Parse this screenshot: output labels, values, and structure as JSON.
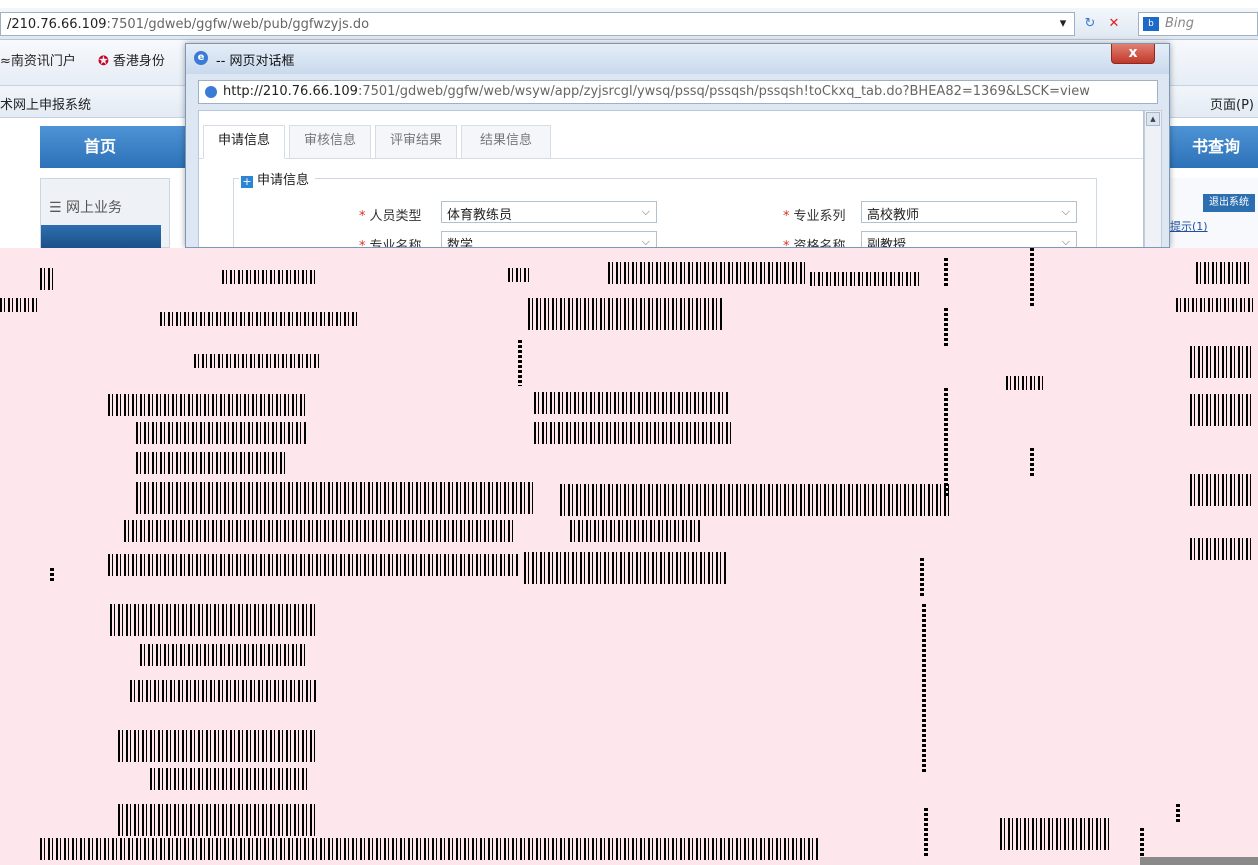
{
  "browser": {
    "address_host": "/210.76.66.109",
    "address_rest": ":7501/gdweb/ggfw/web/pub/ggfwzyjs.do",
    "search_placeholder": "Bing",
    "search_logo": "b",
    "fav1_label": "≈南资讯门户",
    "fav2_label": "香港身份",
    "fav3_label": "术网上申报系统",
    "page_menu": "页面(P)"
  },
  "site": {
    "nav_home": "首页",
    "nav_right": "书查询",
    "left_title": "网上业务",
    "logout": "退出系统",
    "right_link": "提示(1)"
  },
  "dialog": {
    "title": "-- 网页对话框",
    "close": "x",
    "url_host": "http://210.76.66.109",
    "url_rest": ":7501/gdweb/ggfw/web/wsyw/app/zyjsrcgl/ywsq/pssq/pssqsh/pssqsh!toCkxq_tab.do?BHEA82=1369&LSCK=view",
    "tabs": [
      {
        "label": "申请信息"
      },
      {
        "label": "审核信息"
      },
      {
        "label": "评审结果"
      },
      {
        "label": "结果信息"
      }
    ],
    "section_title": "申请信息",
    "fields": {
      "person_type_label": "人员类型",
      "person_type_value": "体育教练员",
      "series_label": "专业系列",
      "series_value": "高校教师",
      "major_label": "专业名称",
      "major_value": "数学",
      "qualification_label": "资格名称",
      "qualification_value": "副教授"
    }
  },
  "colors": {
    "corrupt_bg": "#fde6ec",
    "nav_blue": "#2d72b8",
    "required_star": "#e0301e"
  }
}
